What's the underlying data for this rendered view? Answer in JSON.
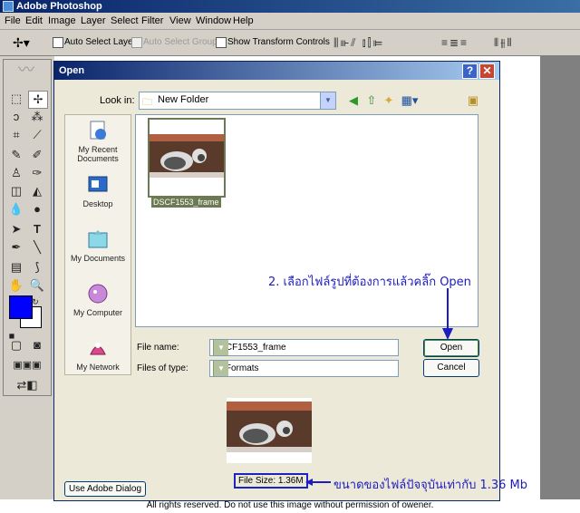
{
  "app": {
    "title": "Adobe Photoshop"
  },
  "menubar": [
    "File",
    "Edit",
    "Image",
    "Layer",
    "Select",
    "Filter",
    "View",
    "Window",
    "Help"
  ],
  "options_bar": {
    "auto_select_layer": "Auto Select Layer",
    "auto_select_groups": "Auto Select Groups",
    "show_transform_controls": "Show Transform Controls"
  },
  "dialog": {
    "title": "Open",
    "help_btn": "?",
    "close_btn": "✕",
    "look_in_label": "Look in:",
    "look_in_value": "New Folder",
    "places": [
      "My Recent Documents",
      "Desktop",
      "My Documents",
      "My Computer",
      "My Network"
    ],
    "file": {
      "name": "DSCF1553_frame"
    },
    "file_name_label": "File name:",
    "file_name_value": "DSCF1553_frame",
    "files_of_type_label": "Files of type:",
    "files_of_type_value": "All Formats",
    "open_btn": "Open",
    "cancel_btn": "Cancel",
    "file_size": "File Size: 1.36M",
    "use_adobe_dialog": "Use Adobe Dialog"
  },
  "annotations": {
    "step2": "2. เลือกไฟล์รูปที่ต้องการแล้วคลิ๊ก Open",
    "size_note": "ขนาดของไฟล์ปัจจุบันเท่ากับ 1.36 Mb"
  },
  "colors": {
    "foreground": "#0000ff",
    "background": "#ffffff",
    "annotation": "#1c1cc0"
  },
  "footer": "All rights reserved. Do not use this image without permission of owener."
}
